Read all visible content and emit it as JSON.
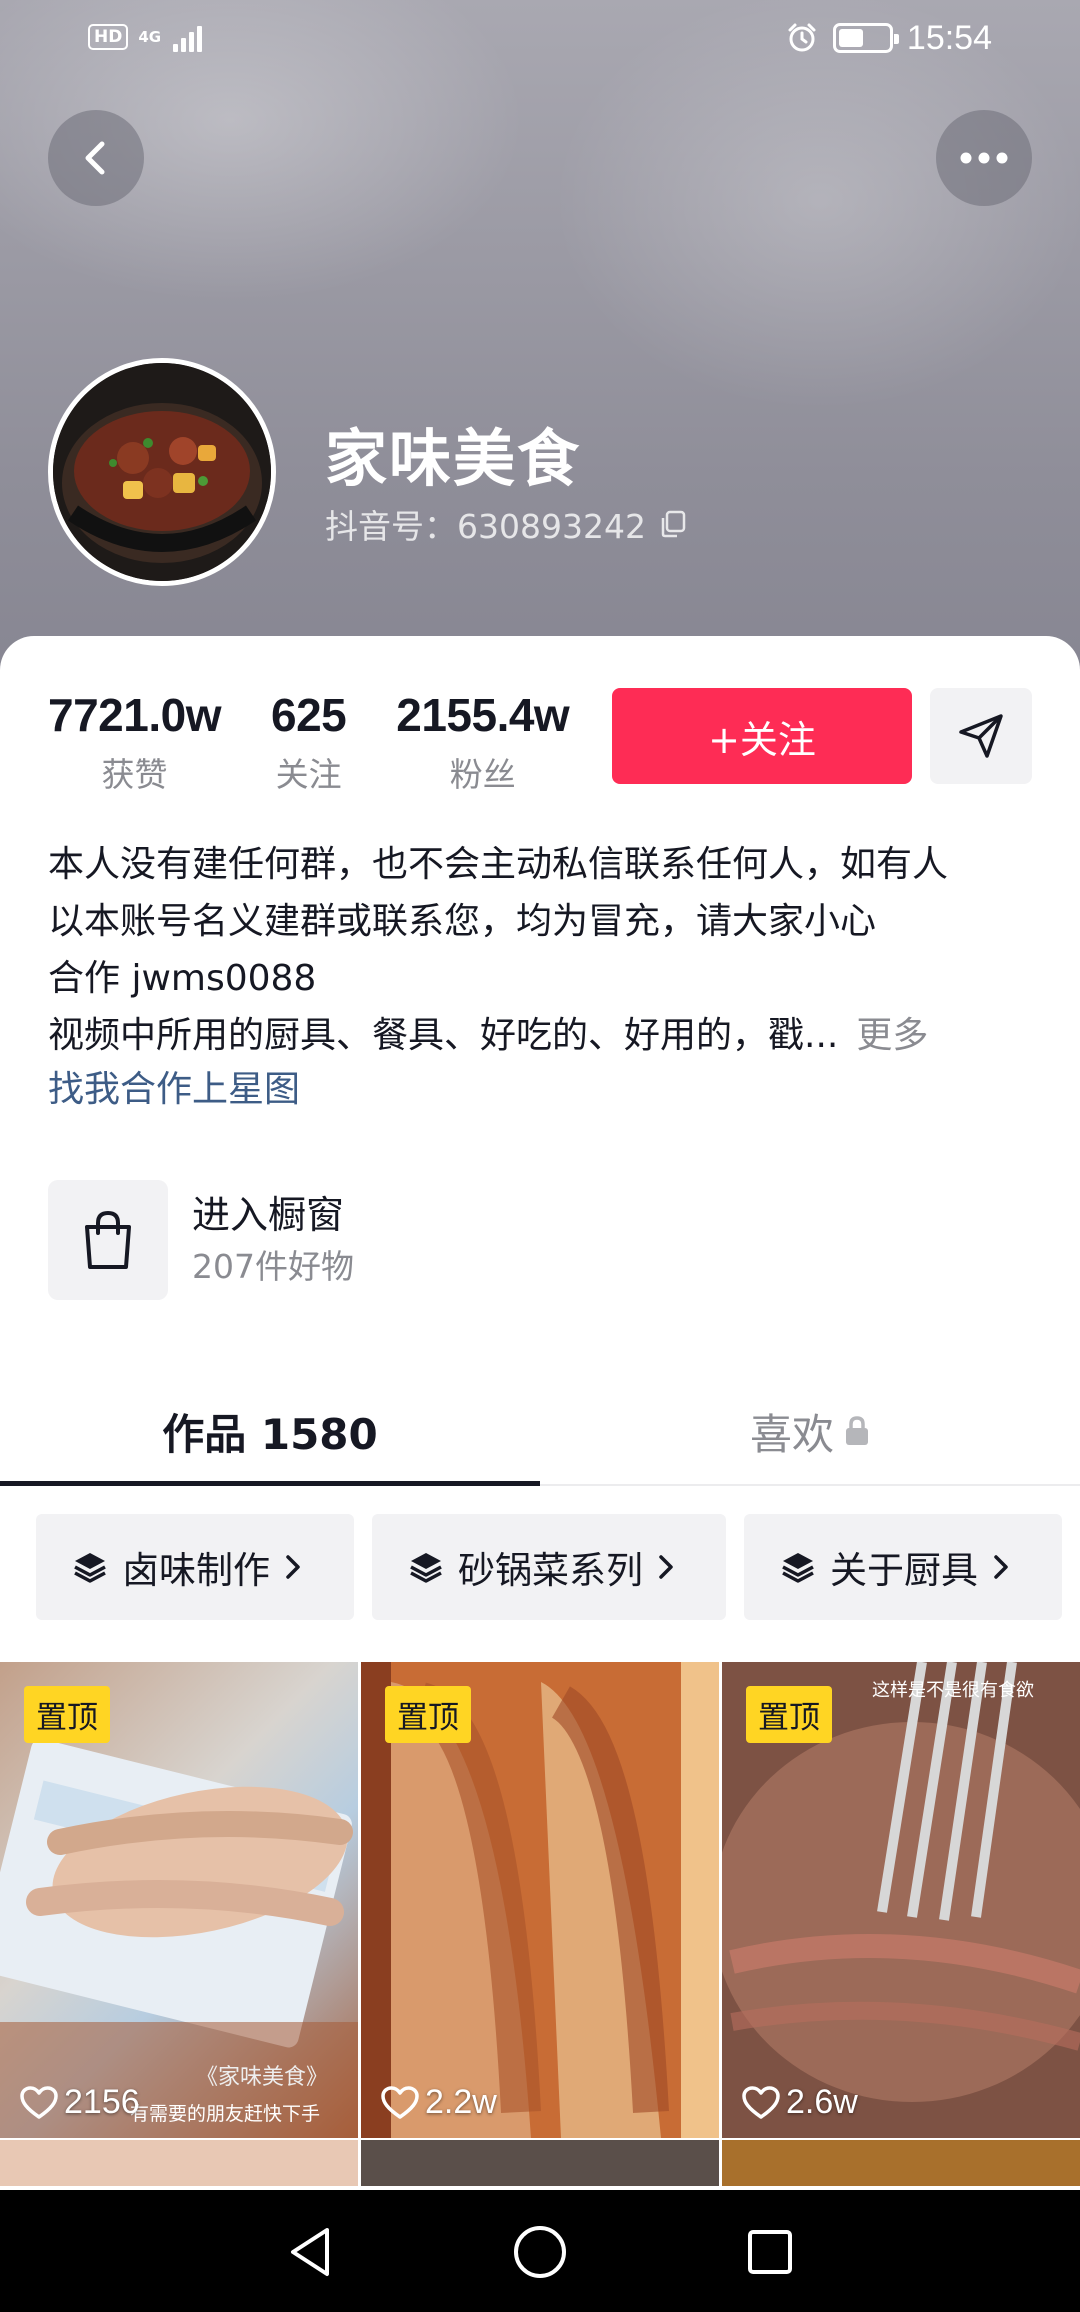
{
  "status_bar": {
    "hd": "HD",
    "network": "4G",
    "time": "15:54",
    "battery_level": 0.5
  },
  "header": {
    "back_icon": "chevron-left-icon",
    "more_icon": "ellipsis-icon"
  },
  "profile": {
    "name": "家味美食",
    "douyin_id": "抖音号：630893242",
    "copy_icon": "copy-icon"
  },
  "stats": [
    {
      "value": "7721.0w",
      "label": "获赞"
    },
    {
      "value": "625",
      "label": "关注"
    },
    {
      "value": "2155.4w",
      "label": "粉丝"
    }
  ],
  "actions": {
    "follow_label": "+关注",
    "share_icon": "send-icon"
  },
  "bio": {
    "lines": [
      "本人没有建任何群，也不会主动私信联系任何人，如有人",
      "以本账号名义建群或联系您，均为冒充，请大家小心",
      "合作 jwms0088",
      "视频中所用的厨具、餐具、好吃的、好用的，戳..."
    ],
    "more_label": "更多",
    "link": "找我合作上星图"
  },
  "shop": {
    "title": "进入橱窗",
    "subtitle": "207件好物",
    "icon": "shopping-bag-icon"
  },
  "tabs": {
    "works": "作品 1580",
    "likes": "喜欢"
  },
  "collections": [
    {
      "label": "卤味制作"
    },
    {
      "label": "砂锅菜系列"
    },
    {
      "label": "关于厨具"
    }
  ],
  "videos": [
    {
      "pin": "置顶",
      "likes": "2156",
      "overlay": "《家味美食》",
      "caption": "有需要的朋友赶快下手"
    },
    {
      "pin": "置顶",
      "likes": "2.2w"
    },
    {
      "pin": "置顶",
      "likes": "2.6w",
      "top_caption": "这样是不是很有食欲"
    }
  ],
  "colors": {
    "accent": "#fe2c55",
    "pin_bg": "#ffd523",
    "link": "#3d5c86"
  }
}
